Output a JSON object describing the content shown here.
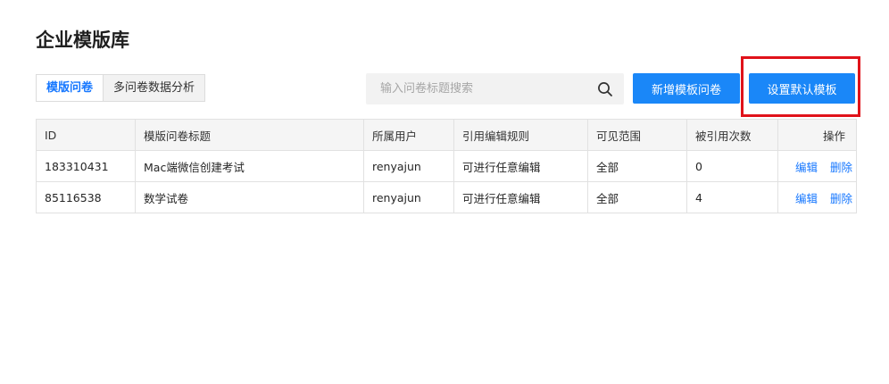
{
  "page": {
    "title": "企业模版库"
  },
  "tabs": [
    {
      "label": "模版问卷",
      "active": true
    },
    {
      "label": "多问卷数据分析",
      "active": false
    }
  ],
  "search": {
    "placeholder": "输入问卷标题搜索",
    "value": ""
  },
  "toolbar": {
    "new_template_label": "新增模板问卷",
    "set_default_label": "设置默认模板"
  },
  "table": {
    "headers": [
      "ID",
      "模版问卷标题",
      "所属用户",
      "引用编辑规则",
      "可见范围",
      "被引用次数",
      "操作"
    ],
    "rows": [
      {
        "id": "183310431",
        "title": "Mac端微信创建考试",
        "owner": "renyajun",
        "rule": "可进行任意编辑",
        "scope": "全部",
        "count": "0",
        "edit": "编辑",
        "delete": "删除"
      },
      {
        "id": "85116538",
        "title": "数学试卷",
        "owner": "renyajun",
        "rule": "可进行任意编辑",
        "scope": "全部",
        "count": "4",
        "edit": "编辑",
        "delete": "删除"
      }
    ]
  },
  "colors": {
    "accent": "#1a87f8",
    "link": "#1677ff",
    "highlight": "#e0121a"
  },
  "icons": {
    "search": "search-icon"
  }
}
